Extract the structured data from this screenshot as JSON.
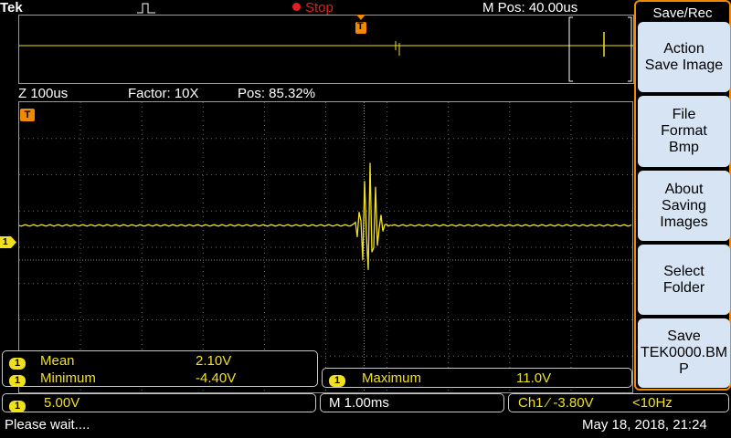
{
  "header": {
    "brand": "Tek",
    "trigger_status": "Stop",
    "m_pos": "M Pos: 40.00us",
    "trigger_marker": "T"
  },
  "zoom_info": {
    "zoom": "Z 100us",
    "factor": "Factor: 10X",
    "pos": "Pos: 85.32%"
  },
  "channel_marker": "1",
  "measurements": [
    {
      "channel": "1",
      "label": "Mean",
      "value": "2.10V"
    },
    {
      "channel": "1",
      "label": "Minimum",
      "value": "-4.40V"
    },
    {
      "channel": "1",
      "label": "Maximum",
      "value": "11.0V"
    }
  ],
  "status_bar": {
    "ch_scale_badge": "1",
    "ch_scale": "5.00V",
    "timebase": "M 1.00ms",
    "trigger": "Ch1 ⁄ -3.80V",
    "freq": "<10Hz",
    "message": "Please wait....",
    "datetime": "May 18, 2018, 21:24"
  },
  "side_menu": {
    "title": "Save/Rec",
    "buttons": [
      {
        "label": "Action\nSave Image"
      },
      {
        "label": "File\nFormat\nBmp"
      },
      {
        "label": "About\nSaving\nImages"
      },
      {
        "label": "Select\nFolder"
      },
      {
        "label": "Save\nTEK0000.BM\nP"
      }
    ]
  },
  "colors": {
    "trace": "#f0e020",
    "accent_orange": "#f08a00",
    "menu_bg": "#d7e4f4",
    "grid": "#6a6a6a"
  }
}
